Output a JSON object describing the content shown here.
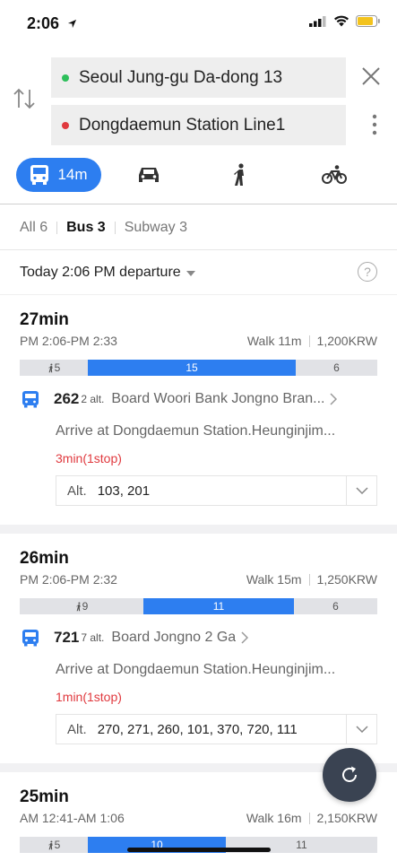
{
  "status_bar": {
    "time": "2:06"
  },
  "route": {
    "origin": "Seoul Jung-gu Da-dong 13",
    "destination": "Dongdaemun Station Line1"
  },
  "modes": {
    "bus_duration": "14m"
  },
  "filters": {
    "all": "All 6",
    "bus": "Bus 3",
    "subway": "Subway 3"
  },
  "departure": {
    "label": "Today 2:06 PM departure"
  },
  "routes": [
    {
      "duration": "27min",
      "timespan": "PM 2:06-PM 2:33",
      "walk": "Walk 11m",
      "fare": "1,200KRW",
      "segments": {
        "walk": "5",
        "ride": "15",
        "rest": "6"
      },
      "bus_number": "262",
      "alt_count": "2 alt.",
      "board": "Board Woori Bank Jongno Bran...",
      "arrive": "Arrive at Dongdaemun Station.Heunginjim...",
      "eta": "3min(1stop)",
      "alt_label": "Alt.",
      "alt_buses": "103, 201"
    },
    {
      "duration": "26min",
      "timespan": "PM 2:06-PM 2:32",
      "walk": "Walk 15m",
      "fare": "1,250KRW",
      "segments": {
        "walk": "9",
        "ride": "11",
        "rest": "6"
      },
      "bus_number": "721",
      "alt_count": "7 alt.",
      "board": "Board Jongno 2 Ga",
      "arrive": "Arrive at Dongdaemun Station.Heunginjim...",
      "eta": "1min(1stop)",
      "alt_label": "Alt.",
      "alt_buses": "270, 271, 260, 101, 370, 720, 111"
    },
    {
      "duration": "25min",
      "timespan": "AM 12:41-AM 1:06",
      "walk": "Walk 16m",
      "fare": "2,150KRW",
      "segments": {
        "walk": "5",
        "ride": "10",
        "rest": "11"
      }
    }
  ],
  "colors": {
    "accent": "#2d7ef0",
    "origin_dot": "#2dbf5a",
    "destination_dot": "#e0393e",
    "eta": "#e0393e"
  }
}
